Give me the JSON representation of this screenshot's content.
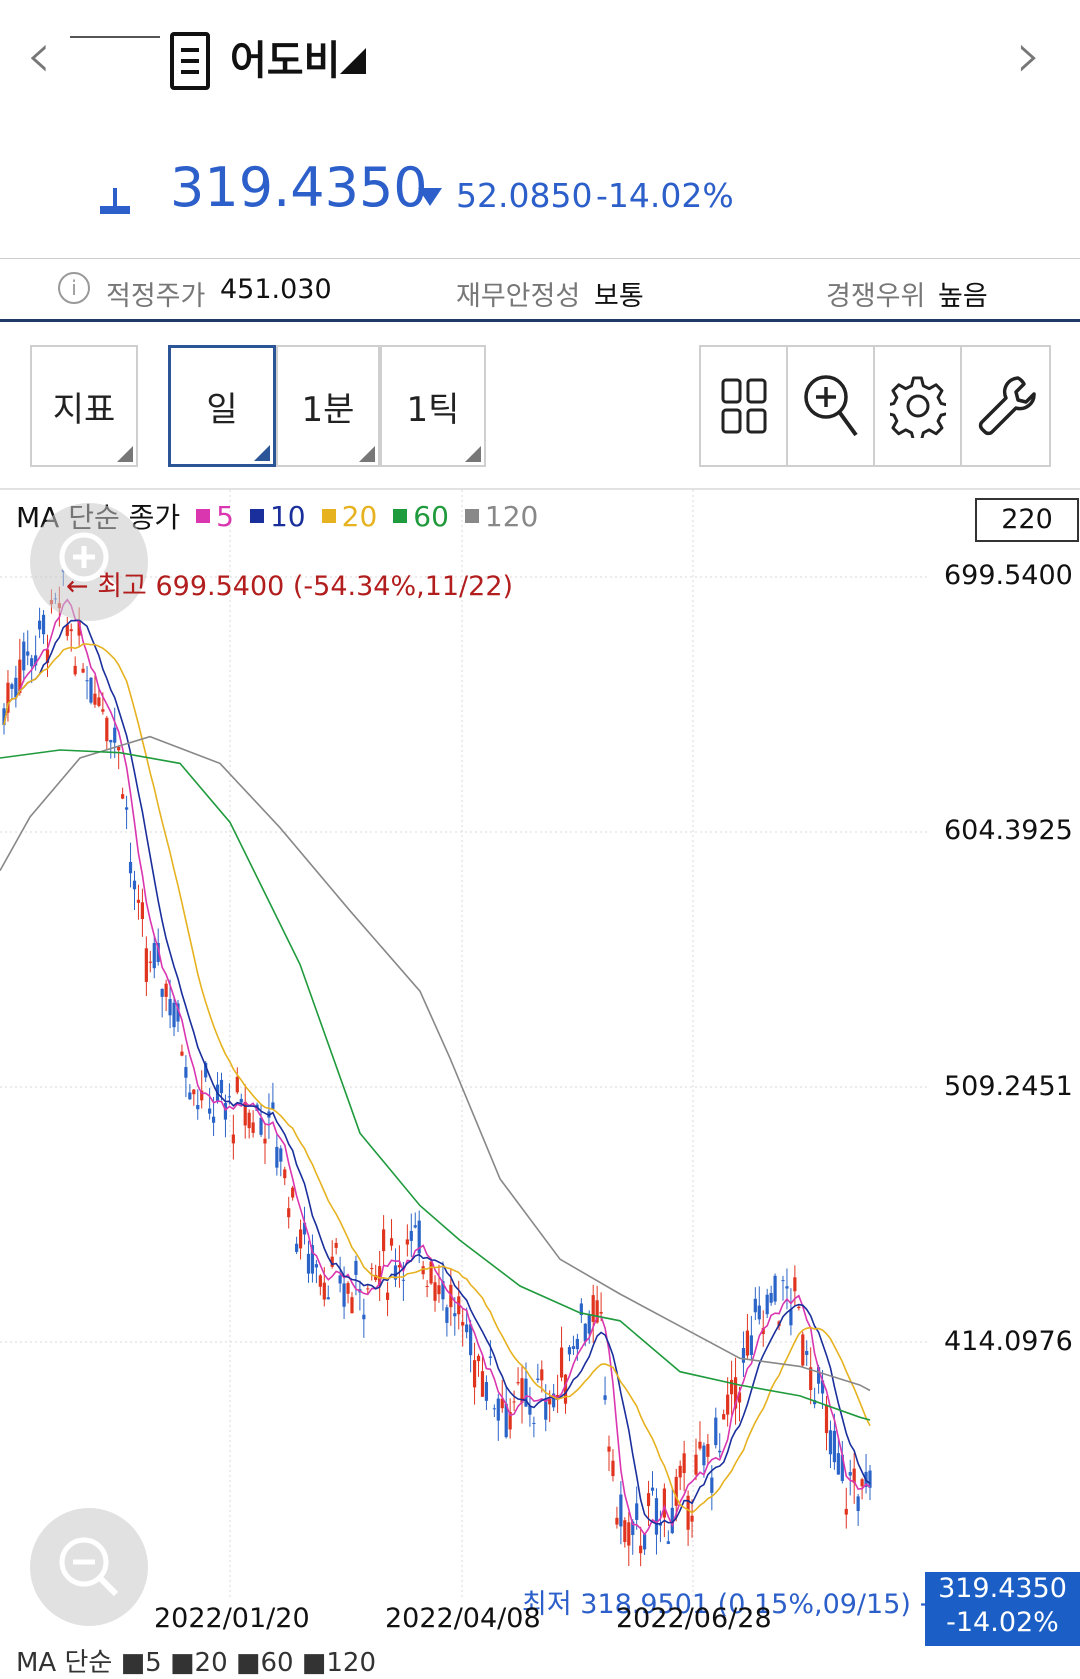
{
  "header": {
    "stock_name": "어도비"
  },
  "quote": {
    "price": "319.4350",
    "change": "52.0850",
    "change_pct": "-14.02%",
    "direction": "down",
    "color": "#2c5fc9"
  },
  "info": {
    "fair_price_label": "적정주가",
    "fair_price_value": "451.030",
    "stability_label": "재무안정성",
    "stability_value": "보통",
    "competition_label": "경쟁우위",
    "competition_value": "높음"
  },
  "toolbar": {
    "indicator_label": "지표",
    "periods": [
      "일",
      "1분",
      "1틱"
    ],
    "selected_period": "일",
    "icons": [
      "grid-icon",
      "zoom-in-icon",
      "settings-icon",
      "wrench-icon"
    ]
  },
  "chart": {
    "legend_title": "MA 단순 종가",
    "ma_periods": [
      "5",
      "10",
      "20",
      "60",
      "120"
    ],
    "ma_colors": [
      "#d936b0",
      "#1a2f9c",
      "#e6b220",
      "#1f9a3c",
      "#888888"
    ],
    "candle_count": "220",
    "high_note": "← 최고 699.5400 (-54.34%,11/22)",
    "low_note": "최저 318.9501 (0.15%,09/15) →",
    "current_price": "319.4350",
    "current_change": "-14.02%",
    "y_ticks": [
      "699.5400",
      "604.3925",
      "509.2451",
      "414.0976"
    ],
    "x_ticks": [
      "2022/01/20",
      "2022/04/08",
      "2022/06/28"
    ],
    "bottom_legend": "MA 단순 ■5 ■20 ■60 ■120"
  },
  "chart_data": {
    "type": "candlestick",
    "ylim": [
      318.9501,
      699.54
    ],
    "series": [
      {
        "name": "120",
        "values": [
          [
            0,
            590
          ],
          [
            30,
            610
          ],
          [
            80,
            632
          ],
          [
            150,
            640
          ],
          [
            220,
            630
          ],
          [
            280,
            606
          ],
          [
            350,
            575
          ],
          [
            420,
            545
          ],
          [
            450,
            520
          ],
          [
            500,
            475
          ],
          [
            560,
            445
          ],
          [
            620,
            432
          ],
          [
            680,
            420
          ],
          [
            740,
            408
          ],
          [
            800,
            405
          ],
          [
            860,
            398
          ],
          [
            870,
            396
          ]
        ]
      },
      {
        "name": "60",
        "values": [
          [
            0,
            632
          ],
          [
            60,
            635
          ],
          [
            120,
            634
          ],
          [
            180,
            630
          ],
          [
            230,
            608
          ],
          [
            300,
            555
          ],
          [
            360,
            492
          ],
          [
            420,
            465
          ],
          [
            460,
            452
          ],
          [
            520,
            435
          ],
          [
            580,
            425
          ],
          [
            620,
            422
          ],
          [
            680,
            403
          ],
          [
            740,
            398
          ],
          [
            800,
            394
          ],
          [
            860,
            386
          ],
          [
            870,
            385
          ]
        ]
      }
    ]
  }
}
